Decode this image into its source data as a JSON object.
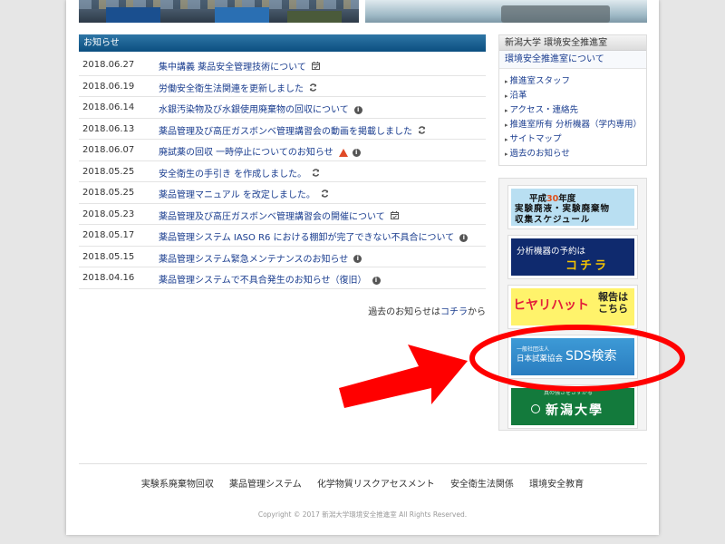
{
  "news": {
    "header": "お知らせ",
    "items": [
      {
        "date": "2018.06.27",
        "title": "集中講義 薬品安全管理技術について",
        "icon": "calendar-icon"
      },
      {
        "date": "2018.06.19",
        "title": "労働安全衛生法関連を更新しました",
        "icon": "refresh-icon"
      },
      {
        "date": "2018.06.14",
        "title": "水銀汚染物及び水銀使用廃棄物の回収について",
        "icon": "info-icon"
      },
      {
        "date": "2018.06.13",
        "title": "薬品管理及び高圧ガスボンベ管理講習会の動画を掲載しました",
        "icon": "refresh-icon"
      },
      {
        "date": "2018.06.07",
        "title": "廃試薬の回収 一時停止についてのお知らせ",
        "icon": "warning-info-icon"
      },
      {
        "date": "2018.05.25",
        "title": "安全衛生の手引き を作成しました。",
        "icon": "refresh-icon"
      },
      {
        "date": "2018.05.25",
        "title": "薬品管理マニュアル を改定しました。",
        "icon": "refresh-icon"
      },
      {
        "date": "2018.05.23",
        "title": "薬品管理及び高圧ガスボンベ管理講習会の開催について",
        "icon": "calendar-icon"
      },
      {
        "date": "2018.05.17",
        "title": "薬品管理システム IASO R6 における棚卸が完了できない不具合について",
        "icon": "info-icon"
      },
      {
        "date": "2018.05.15",
        "title": "薬品管理システム緊急メンテナンスのお知らせ",
        "icon": "info-icon"
      },
      {
        "date": "2018.04.16",
        "title": "薬品管理システムで不具合発生のお知らせ（復旧）",
        "icon": "info-icon"
      }
    ],
    "more_prefix": "過去のお知らせは",
    "more_link": "コチラ",
    "more_suffix": "から"
  },
  "sidebar": {
    "title": "新潟大学 環境安全推進室",
    "about": "環境安全推進室について",
    "links": [
      "推進室スタッフ",
      "沿革",
      "アクセス・連絡先",
      "推進室所有 分析機器（学内専用）",
      "サイトマップ",
      "過去のお知らせ"
    ]
  },
  "banners": {
    "b1_year_pre": "平成",
    "b1_year": "30",
    "b1_year_post": "年度",
    "b1_line2": "実験廃液・実験廃棄物",
    "b1_line3": "収集スケジュール",
    "b2_line1": "分析機器の予約は",
    "b2_line2": "コチラ",
    "b3_main": "ヒヤリハット",
    "b3_side1": "報告は",
    "b3_side2": "こちら",
    "b4_small": "一般社団法人",
    "b4_org": "日本試薬協会",
    "b4_main": "SDS検索",
    "b5_small": "真の強さをさずかる",
    "b5_main": "新潟大學"
  },
  "footer": {
    "links": [
      "実験系廃棄物回収",
      "薬品管理システム",
      "化学物質リスクアセスメント",
      "安全衛生法関係",
      "環境安全教育"
    ],
    "copyright": "Copyright © 2017 新潟大学環境安全推進室 All Rights Reserved."
  },
  "colors": {
    "accent": "#0b4f80",
    "link": "#1a3d8f",
    "annotation": "#ff0000"
  }
}
